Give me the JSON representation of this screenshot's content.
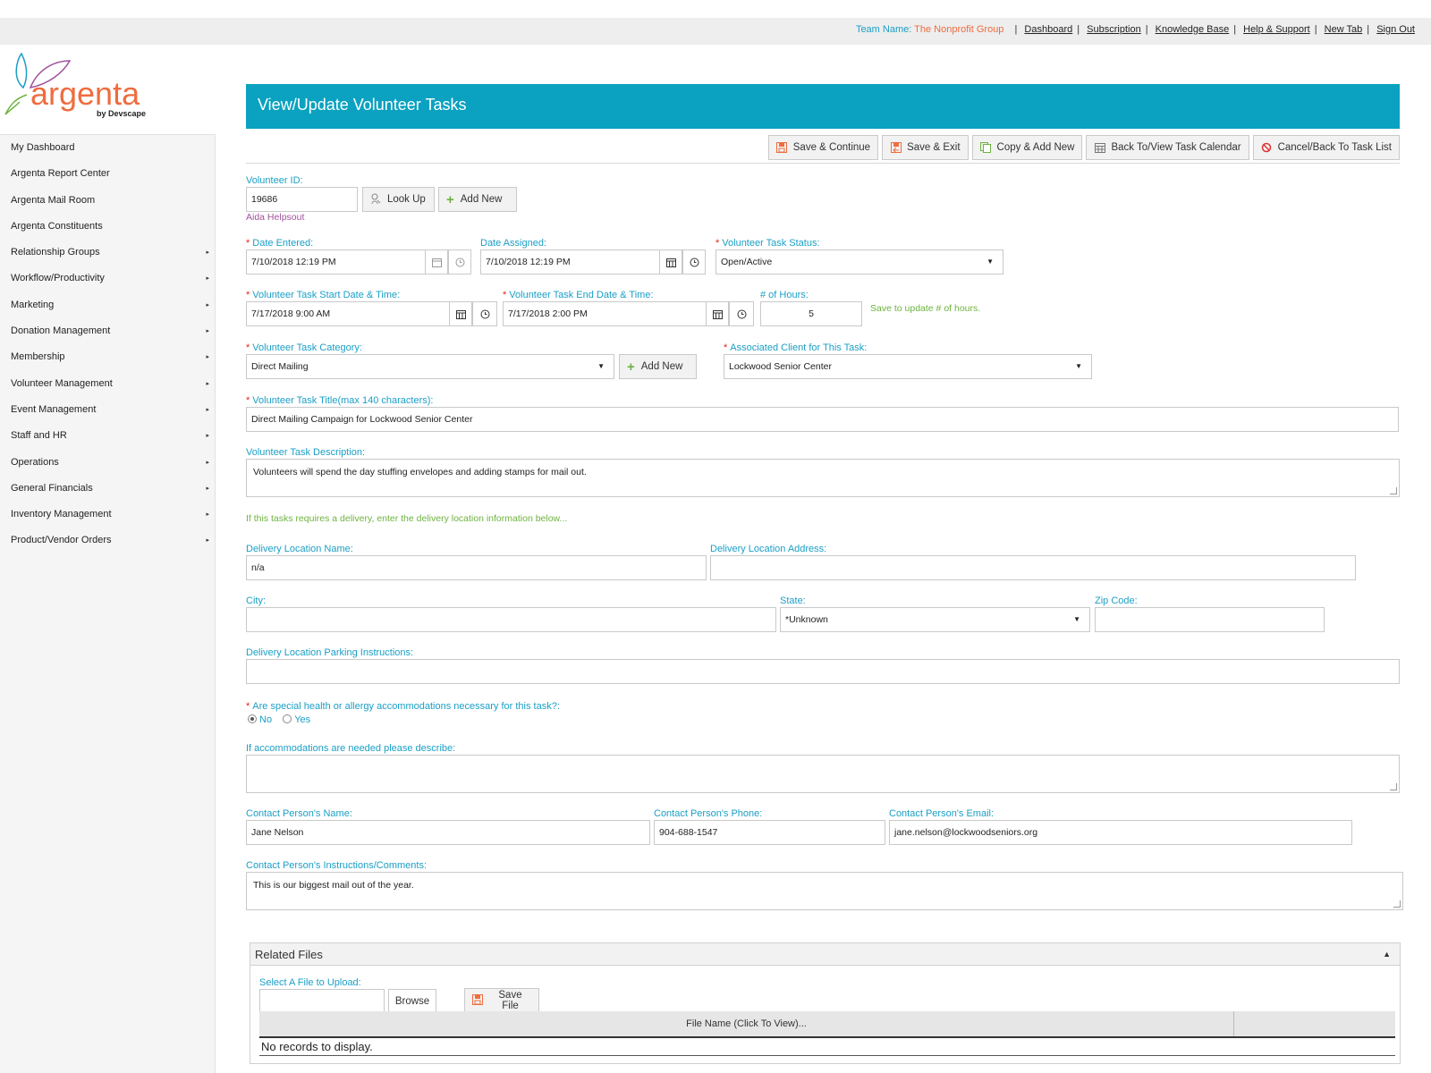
{
  "topbar": {
    "team_label": "Team Name:",
    "team_name": "The Nonprofit Group",
    "links": [
      "Dashboard",
      "Subscription",
      "Knowledge Base",
      "Help & Support",
      "New Tab",
      "Sign Out"
    ]
  },
  "logo": {
    "word": "argenta",
    "by": "by Devscape"
  },
  "sidebar": {
    "items": [
      {
        "label": "My Dashboard",
        "arrow": ""
      },
      {
        "label": "Argenta Report Center",
        "arrow": ""
      },
      {
        "label": "Argenta Mail Room",
        "arrow": ""
      },
      {
        "label": "Argenta Constituents",
        "arrow": ""
      },
      {
        "label": "Relationship Groups",
        "arrow": "▸"
      },
      {
        "label": "Workflow/Productivity",
        "arrow": "▸"
      },
      {
        "label": "Marketing",
        "arrow": "▸"
      },
      {
        "label": "Donation Management",
        "arrow": "▸"
      },
      {
        "label": "Membership",
        "arrow": "▸"
      },
      {
        "label": "Volunteer Management",
        "arrow": "▸"
      },
      {
        "label": "Event Management",
        "arrow": "▸"
      },
      {
        "label": "Staff and HR",
        "arrow": "▸"
      },
      {
        "label": "Operations",
        "arrow": "▸"
      },
      {
        "label": "General Financials",
        "arrow": "▸"
      },
      {
        "label": "Inventory Management",
        "arrow": "▸"
      },
      {
        "label": "Product/Vendor Orders",
        "arrow": "▸"
      }
    ]
  },
  "page": {
    "title": "View/Update Volunteer Tasks"
  },
  "toolbar": {
    "save_continue": "Save & Continue",
    "save_exit": "Save & Exit",
    "copy_add": "Copy & Add New",
    "back_calendar": "Back To/View Task Calendar",
    "cancel": "Cancel/Back To Task List"
  },
  "form": {
    "volunteer_id_label": "Volunteer ID:",
    "volunteer_id": "19686",
    "lookup": "Look Up",
    "add_new": "Add New",
    "volunteer_name": "Aida Helpsout",
    "req": "*",
    "date_entered_label": "Date Entered:",
    "date_entered": "7/10/2018 12:19 PM",
    "date_assigned_label": "Date Assigned:",
    "date_assigned": "7/10/2018 12:19 PM",
    "status_label": "Volunteer Task Status:",
    "status": "Open/Active",
    "start_label": "Volunteer Task Start Date & Time:",
    "start": "7/17/2018 9:00 AM",
    "end_label": "Volunteer Task End Date & Time:",
    "end": "7/17/2018 2:00 PM",
    "hours_label": "# of Hours:",
    "hours": "5",
    "hours_note": "Save to update # of hours.",
    "category_label": "Volunteer Task Category:",
    "category": "Direct Mailing",
    "client_label": "Associated Client for This Task:",
    "client": "Lockwood Senior Center",
    "title_label": "Volunteer Task Title(max 140 characters):",
    "title": "Direct Mailing Campaign for Lockwood Senior Center",
    "desc_label": "Volunteer Task Description:",
    "desc": "Volunteers will spend the day stuffing envelopes and adding stamps for mail out.",
    "delivery_note": "If this tasks requires a delivery, enter the delivery location information below...",
    "loc_name_label": "Delivery Location Name:",
    "loc_name": "n/a",
    "loc_addr_label": "Delivery Location Address:",
    "loc_addr": "",
    "city_label": "City:",
    "city": "",
    "state_label": "State:",
    "state": "*Unknown",
    "zip_label": "Zip Code:",
    "zip": "",
    "parking_label": "Delivery Location Parking Instructions:",
    "parking": "",
    "health_label": "Are special health or allergy accommodations necessary for this task?:",
    "health_no": "No",
    "health_yes": "Yes",
    "accom_label": "If accommodations are needed please describe:",
    "accom": "",
    "contact_name_label": "Contact Person's Name:",
    "contact_name": "Jane Nelson",
    "contact_phone_label": "Contact Person's Phone:",
    "contact_phone": "904-688-1547",
    "contact_email_label": "Contact Person's Email:",
    "contact_email": "jane.nelson@lockwoodseniors.org",
    "contact_comments_label": "Contact Person's Instructions/Comments:",
    "contact_comments": "This is our biggest mail out of the year."
  },
  "files": {
    "title": "Related Files",
    "select_label": "Select A File to Upload:",
    "browse": "Browse",
    "save_file": "Save File",
    "col_name": "File Name (Click To View)...",
    "empty": "No records to display."
  },
  "colors": {
    "header": "#0aa2c0",
    "label": "#1a9fc6",
    "accent": "#ef6c3f",
    "green": "#6db33f"
  }
}
